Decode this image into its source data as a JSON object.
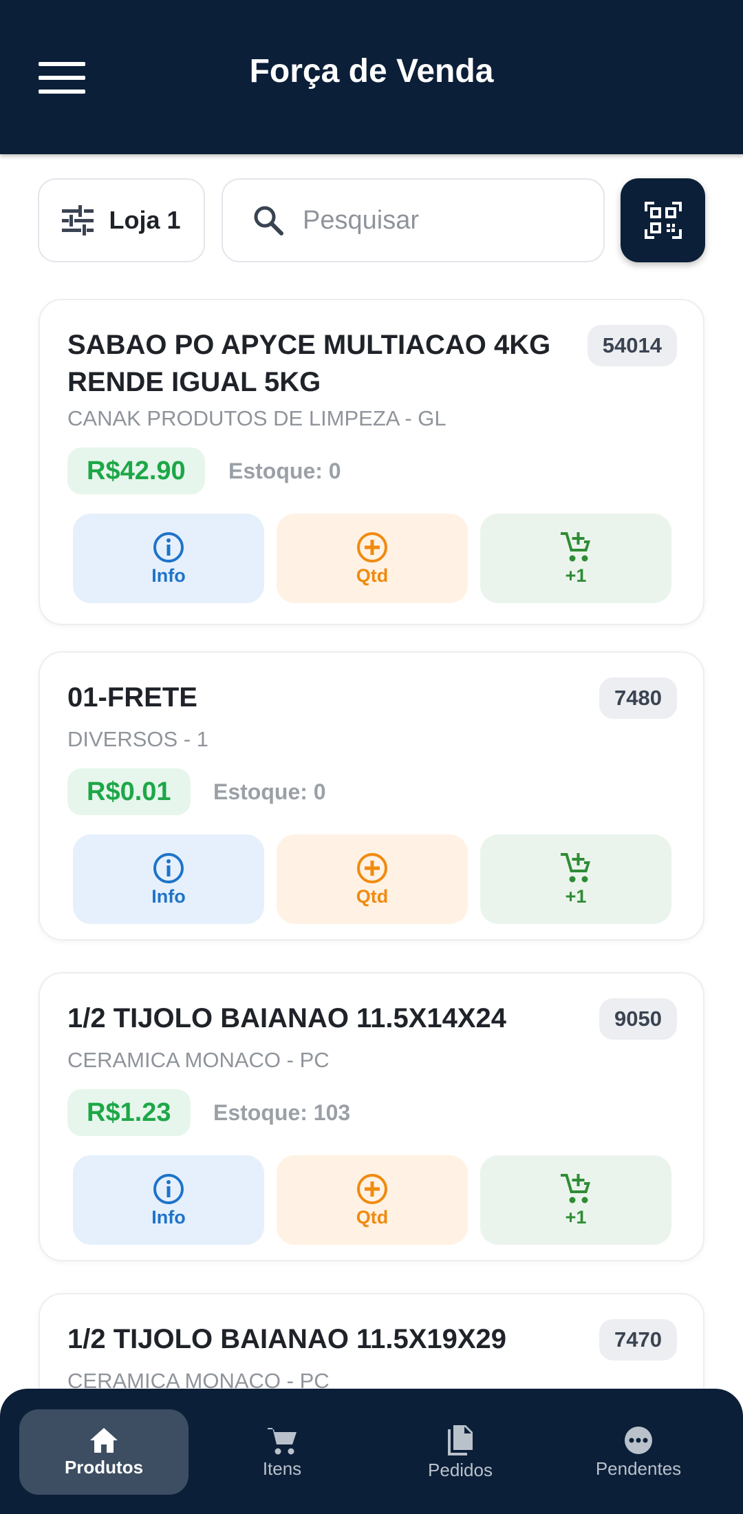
{
  "header": {
    "title": "Força de Venda",
    "menu_icon": "hamburger-menu-icon"
  },
  "filters": {
    "store_label": "Loja 1",
    "store_icon": "tune-sliders-icon",
    "search_placeholder": "Pesquisar",
    "search_value": "",
    "search_icon": "search-icon",
    "qr_icon": "qr-code-scanner-icon"
  },
  "actions": {
    "info_label": "Info",
    "qty_label": "Qtd",
    "add_label": "+1"
  },
  "products": [
    {
      "name": "SABAO PO APYCE MULTIACAO 4KG RENDE IGUAL 5KG",
      "code": "54014",
      "supplier": "CANAK PRODUTOS DE LIMPEZA - GL",
      "price": "R$42.90",
      "stock": "Estoque: 0"
    },
    {
      "name": "01-FRETE",
      "code": "7480",
      "supplier": "DIVERSOS - 1",
      "price": "R$0.01",
      "stock": "Estoque: 0"
    },
    {
      "name": "1/2 TIJOLO BAIANAO 11.5X14X24",
      "code": "9050",
      "supplier": "CERAMICA MONACO - PC",
      "price": "R$1.23",
      "stock": "Estoque: 103"
    },
    {
      "name": "1/2 TIJOLO BAIANAO 11.5X19X29",
      "code": "7470",
      "supplier": "CERAMICA MONACO - PC"
    }
  ],
  "nav": {
    "items": [
      {
        "label": "Produtos",
        "icon": "home-icon",
        "active": true
      },
      {
        "label": "Itens",
        "icon": "cart-icon"
      },
      {
        "label": "Pedidos",
        "icon": "documents-icon"
      },
      {
        "label": "Pendentes",
        "icon": "more-dots-icon"
      }
    ]
  },
  "colors": {
    "primary": "#0c1f38",
    "price_green": "#1ea748",
    "info_blue": "#1e73c8",
    "qty_orange": "#f08a10",
    "add_green": "#2e8c35"
  }
}
